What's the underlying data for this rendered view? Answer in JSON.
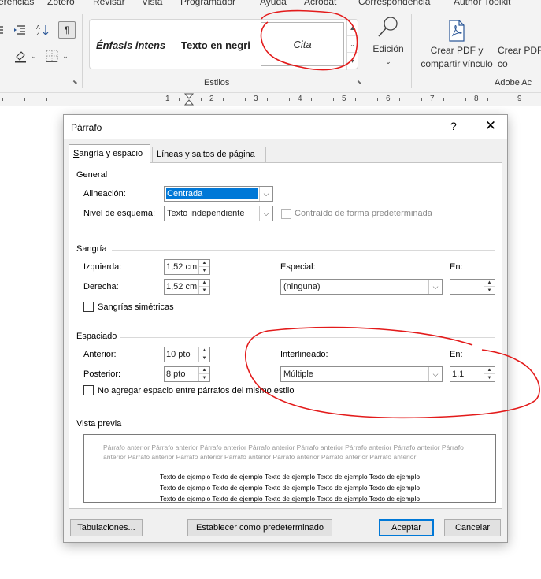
{
  "ribbon": {
    "tabs": [
      "erencias",
      "Zotero",
      "Revisar",
      "Vista",
      "Programador",
      "Ayuda",
      "Acrobat",
      "Correspondencia",
      "Author Toolkit"
    ],
    "styles_gallery": [
      "Énfasis intens",
      "Texto en negri",
      "Cita"
    ],
    "styles_group_label": "Estilos",
    "edit_label": "Edición",
    "pdf_create_share": "Crear PDF y\ncompartir vínculo",
    "pdf_create_2": "Crear PDF\nco",
    "adobe_group_label": "Adobe Ac"
  },
  "ruler": {
    "numbers": [
      "1",
      "2",
      "3",
      "4",
      "5",
      "6",
      "7",
      "8",
      "9"
    ]
  },
  "dialog": {
    "title": "Párrafo",
    "help": "?",
    "close": "✕",
    "tabs": [
      {
        "label": "Sangría y espacio",
        "underline_char": "S"
      },
      {
        "label": "Líneas y saltos de página",
        "underline_char": "L"
      }
    ],
    "general": {
      "title": "General",
      "alignment_label": "Alineación:",
      "alignment_value": "Centrada",
      "outline_label": "Nivel de esquema:",
      "outline_value": "Texto independiente",
      "collapsed_label": "Contraído de forma predeterminada"
    },
    "indent": {
      "title": "Sangría",
      "left_label": "Izquierda:",
      "left_value": "1,52 cm",
      "right_label": "Derecha:",
      "right_value": "1,52 cm",
      "special_label": "Especial:",
      "special_value": "(ninguna)",
      "by_label": "En:",
      "by_value": "",
      "mirror_label": "Sangrías simétricas"
    },
    "spacing": {
      "title": "Espaciado",
      "before_label": "Anterior:",
      "before_value": "10 pto",
      "after_label": "Posterior:",
      "after_value": "8 pto",
      "line_label": "Interlineado:",
      "line_value": "Múltiple",
      "at_label": "En:",
      "at_value": "1,1",
      "no_space_label": "No agregar espacio entre párrafos del mismo estilo"
    },
    "preview": {
      "title": "Vista previa",
      "previous_text": "Párrafo anterior Párrafo anterior Párrafo anterior Párrafo anterior Párrafo anterior Párrafo anterior Párrafo anterior Párrafo anterior Párrafo anterior Párrafo anterior Párrafo anterior Párrafo anterior Párrafo anterior Párrafo anterior",
      "sample_lines": [
        "Texto de ejemplo Texto de ejemplo Texto de ejemplo Texto de ejemplo Texto de ejemplo",
        "Texto de ejemplo Texto de ejemplo Texto de ejemplo Texto de ejemplo Texto de ejemplo",
        "Texto de ejemplo Texto de ejemplo Texto de ejemplo Texto de ejemplo Texto de ejemplo"
      ]
    },
    "buttons": {
      "tabs": "Tabulaciones...",
      "set_default": "Establecer como predeterminado",
      "ok": "Aceptar",
      "cancel": "Cancelar"
    }
  },
  "colors": {
    "accent": "#0078d7",
    "annotation": "#e31b1b"
  }
}
